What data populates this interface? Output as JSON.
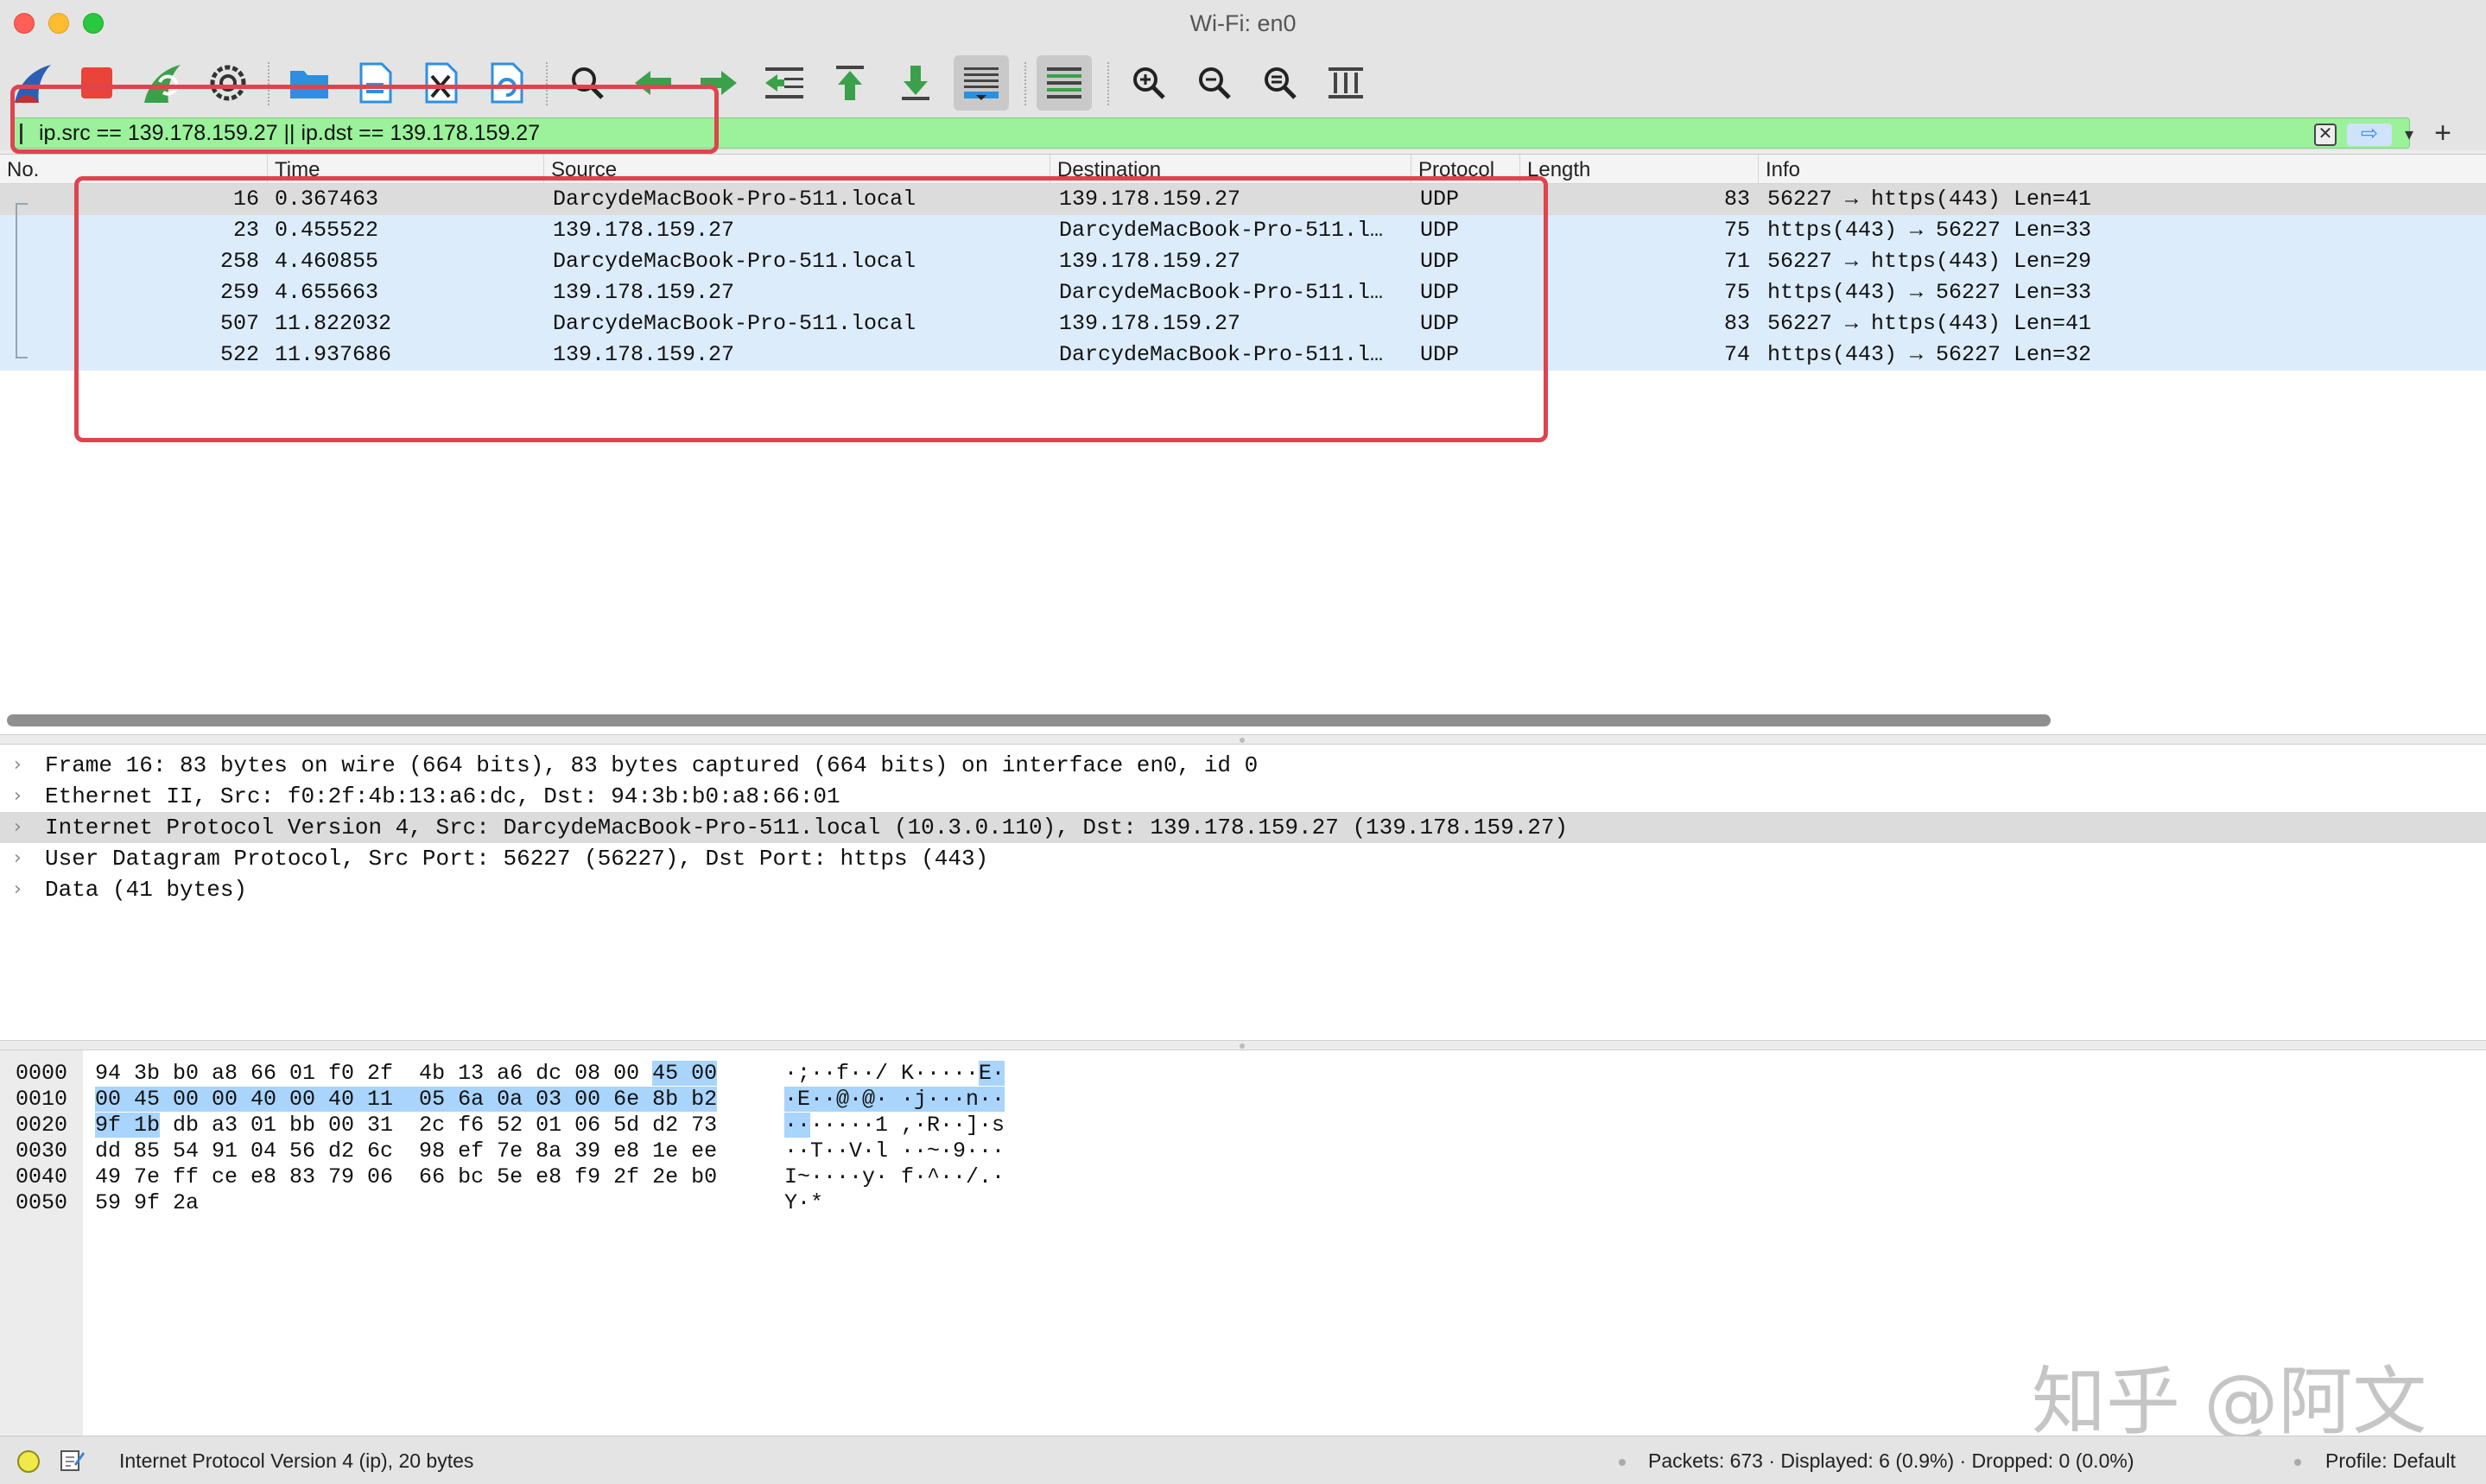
{
  "window": {
    "title": "Wi-Fi: en0"
  },
  "toolbar": {
    "buttons": [
      {
        "name": "start-capture-icon"
      },
      {
        "name": "stop-capture-icon"
      },
      {
        "name": "restart-capture-icon"
      },
      {
        "name": "capture-options-icon"
      },
      {
        "name": "open-file-icon"
      },
      {
        "name": "save-file-icon"
      },
      {
        "name": "close-file-icon"
      },
      {
        "name": "reload-file-icon"
      },
      {
        "name": "find-packet-icon"
      },
      {
        "name": "go-back-icon"
      },
      {
        "name": "go-forward-icon"
      },
      {
        "name": "go-to-packet-icon"
      },
      {
        "name": "go-first-packet-icon"
      },
      {
        "name": "go-last-packet-icon"
      },
      {
        "name": "auto-scroll-icon"
      },
      {
        "name": "colorize-icon"
      },
      {
        "name": "zoom-in-icon"
      },
      {
        "name": "zoom-out-icon"
      },
      {
        "name": "normal-size-icon"
      },
      {
        "name": "resize-columns-icon"
      }
    ]
  },
  "filter": {
    "value": "ip.src == 139.178.159.27 || ip.dst == 139.178.159.27",
    "clear_symbol": "✕",
    "apply_symbol": "⇨",
    "dropdown_symbol": "▾",
    "add_symbol": "+",
    "background_color": "#9bf29b"
  },
  "packet_list": {
    "columns": [
      "No.",
      "Time",
      "Source",
      "Destination",
      "Protocol",
      "Length",
      "Info"
    ],
    "rows": [
      {
        "no": "16",
        "time": "0.367463",
        "source": "DarcydeMacBook-Pro-511.local",
        "destination": "139.178.159.27",
        "protocol": "UDP",
        "length": "83",
        "info": "56227 → https(443) Len=41",
        "selected": true
      },
      {
        "no": "23",
        "time": "0.455522",
        "source": "139.178.159.27",
        "destination": "DarcydeMacBook-Pro-511.l…",
        "protocol": "UDP",
        "length": "75",
        "info": "https(443) → 56227 Len=33",
        "selected": false
      },
      {
        "no": "258",
        "time": "4.460855",
        "source": "DarcydeMacBook-Pro-511.local",
        "destination": "139.178.159.27",
        "protocol": "UDP",
        "length": "71",
        "info": "56227 → https(443) Len=29",
        "selected": false
      },
      {
        "no": "259",
        "time": "4.655663",
        "source": "139.178.159.27",
        "destination": "DarcydeMacBook-Pro-511.l…",
        "protocol": "UDP",
        "length": "75",
        "info": "https(443) → 56227 Len=33",
        "selected": false
      },
      {
        "no": "507",
        "time": "11.822032",
        "source": "DarcydeMacBook-Pro-511.local",
        "destination": "139.178.159.27",
        "protocol": "UDP",
        "length": "83",
        "info": "56227 → https(443) Len=41",
        "selected": false
      },
      {
        "no": "522",
        "time": "11.937686",
        "source": "139.178.159.27",
        "destination": "DarcydeMacBook-Pro-511.l…",
        "protocol": "UDP",
        "length": "74",
        "info": "https(443) → 56227 Len=32",
        "selected": false
      }
    ],
    "row_color": "#dcecfb",
    "selected_color": "#dcdcdc"
  },
  "details": {
    "chevron": "›",
    "rows": [
      {
        "text": "Frame 16: 83 bytes on wire (664 bits), 83 bytes captured (664 bits) on interface en0, id 0",
        "highlighted": false
      },
      {
        "text": "Ethernet II, Src: f0:2f:4b:13:a6:dc, Dst: 94:3b:b0:a8:66:01",
        "highlighted": false
      },
      {
        "text": "Internet Protocol Version 4, Src: DarcydeMacBook-Pro-511.local (10.3.0.110), Dst: 139.178.159.27 (139.178.159.27)",
        "highlighted": true
      },
      {
        "text": "User Datagram Protocol, Src Port: 56227 (56227), Dst Port: https (443)",
        "highlighted": false
      },
      {
        "text": "Data (41 bytes)",
        "highlighted": false
      }
    ]
  },
  "bytes": {
    "rows": [
      {
        "offset": "0000",
        "hex_a": "94 3b b0 a8 66 01 f0 2f  4b 13 a6 dc 08 00 ",
        "hex_hi": "45 00",
        "hex_b": "",
        "asc_a": "·;··f··/ K·····",
        "asc_hi": "E·",
        "asc_b": ""
      },
      {
        "offset": "0010",
        "hex_a": "",
        "hex_hi": "00 45 00 00 40 00 40 11  05 6a 0a 03 00 6e 8b b2",
        "hex_b": "",
        "asc_a": "",
        "asc_hi": "·E··@·@· ·j···n··",
        "asc_b": ""
      },
      {
        "offset": "0020",
        "hex_a": "",
        "hex_hi": "9f 1b",
        "hex_b": " db a3 01 bb 00 31  2c f6 52 01 06 5d d2 73",
        "asc_a": "",
        "asc_hi": "··",
        "asc_b": "·····1 ,·R··]·s"
      },
      {
        "offset": "0030",
        "hex_a": "dd 85 54 91 04 56 d2 6c  98 ef 7e 8a 39 e8 1e ee",
        "hex_hi": "",
        "hex_b": "",
        "asc_a": "··T··V·l ··~·9···",
        "asc_hi": "",
        "asc_b": ""
      },
      {
        "offset": "0040",
        "hex_a": "49 7e ff ce e8 83 79 06  66 bc 5e e8 f9 2f 2e b0",
        "hex_hi": "",
        "hex_b": "",
        "asc_a": "I~····y· f·^··/.·",
        "asc_hi": "",
        "asc_b": ""
      },
      {
        "offset": "0050",
        "hex_a": "59 9f 2a",
        "hex_hi": "",
        "hex_b": "",
        "asc_a": "Y·*",
        "asc_hi": "",
        "asc_b": ""
      }
    ],
    "highlight_color": "#a9d4fc"
  },
  "watermark": "知乎 @阿文",
  "status": {
    "field_info": "Internet Protocol Version 4 (ip), 20 bytes",
    "packets": "Packets: 673 · Displayed: 6 (0.9%) · Dropped: 0 (0.0%)",
    "profile": "Profile: Default"
  },
  "annotations": {
    "color": "#e0434d"
  }
}
